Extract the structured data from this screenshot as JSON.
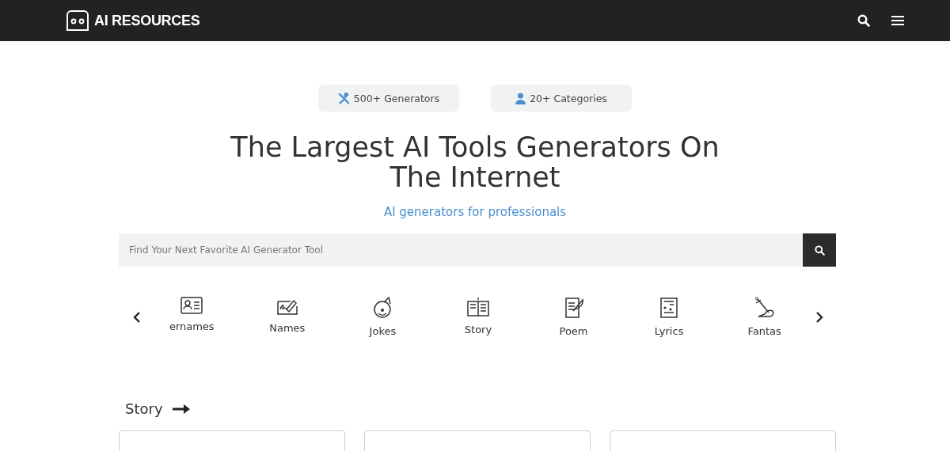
{
  "header": {
    "logo_text": "AI RESOURCES"
  },
  "stats": [
    {
      "kind": "tools",
      "label": "500+ Generators"
    },
    {
      "kind": "person",
      "label": "20+ Categories"
    }
  ],
  "hero": {
    "title_lines": [
      "The Largest AI Tools Generators On",
      "The Internet"
    ],
    "subtitle": "AI generators for professionals"
  },
  "search": {
    "placeholder": "Find Your Next Favorite AI Generator Tool"
  },
  "categories": [
    {
      "kind": "id-card",
      "label": "ernames"
    },
    {
      "kind": "signature",
      "label": "Names"
    },
    {
      "kind": "clown",
      "label": "Jokes"
    },
    {
      "kind": "book",
      "label": "Story"
    },
    {
      "kind": "scroll",
      "label": "Poem"
    },
    {
      "kind": "music-sheet",
      "label": "Lyrics"
    },
    {
      "kind": "sword",
      "label": "Fantas"
    }
  ],
  "section": {
    "title": "Story"
  }
}
